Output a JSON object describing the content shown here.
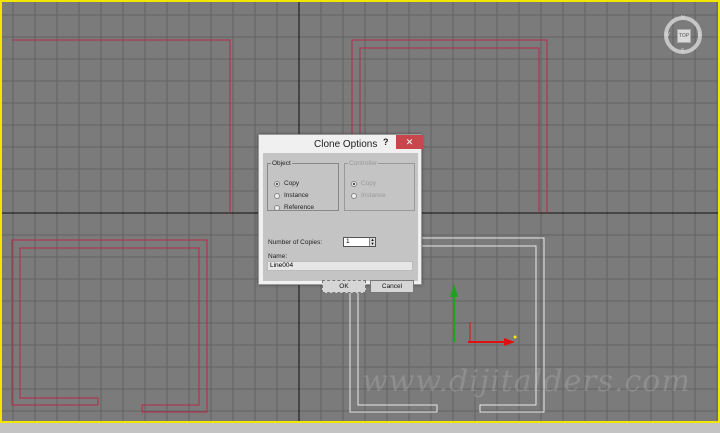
{
  "dialog": {
    "title": "Clone Options",
    "help": "?",
    "close": "✕",
    "object_group": {
      "legend": "Object",
      "options": [
        {
          "label": "Copy",
          "selected": true
        },
        {
          "label": "Instance",
          "selected": false
        },
        {
          "label": "Reference",
          "selected": false
        }
      ]
    },
    "controller_group": {
      "legend": "Controller",
      "enabled": false,
      "options": [
        {
          "label": "Copy",
          "selected": true
        },
        {
          "label": "Instance",
          "selected": false
        }
      ]
    },
    "copies_label": "Number of Copies:",
    "copies_value": "1",
    "name_label": "Name:",
    "name_value": "Line004",
    "ok": "OK",
    "cancel": "Cancel"
  },
  "viewcube": {
    "face": "TOP",
    "n": "N",
    "e": "E",
    "s": "S",
    "w": "W"
  },
  "watermark": "www.dijitalders.com",
  "colors": {
    "viewport": "#7b7b7b",
    "border": "#f2e600",
    "shape_selected": "#ffffff",
    "shape": "#b4284a",
    "close_button": "#c9474c"
  }
}
